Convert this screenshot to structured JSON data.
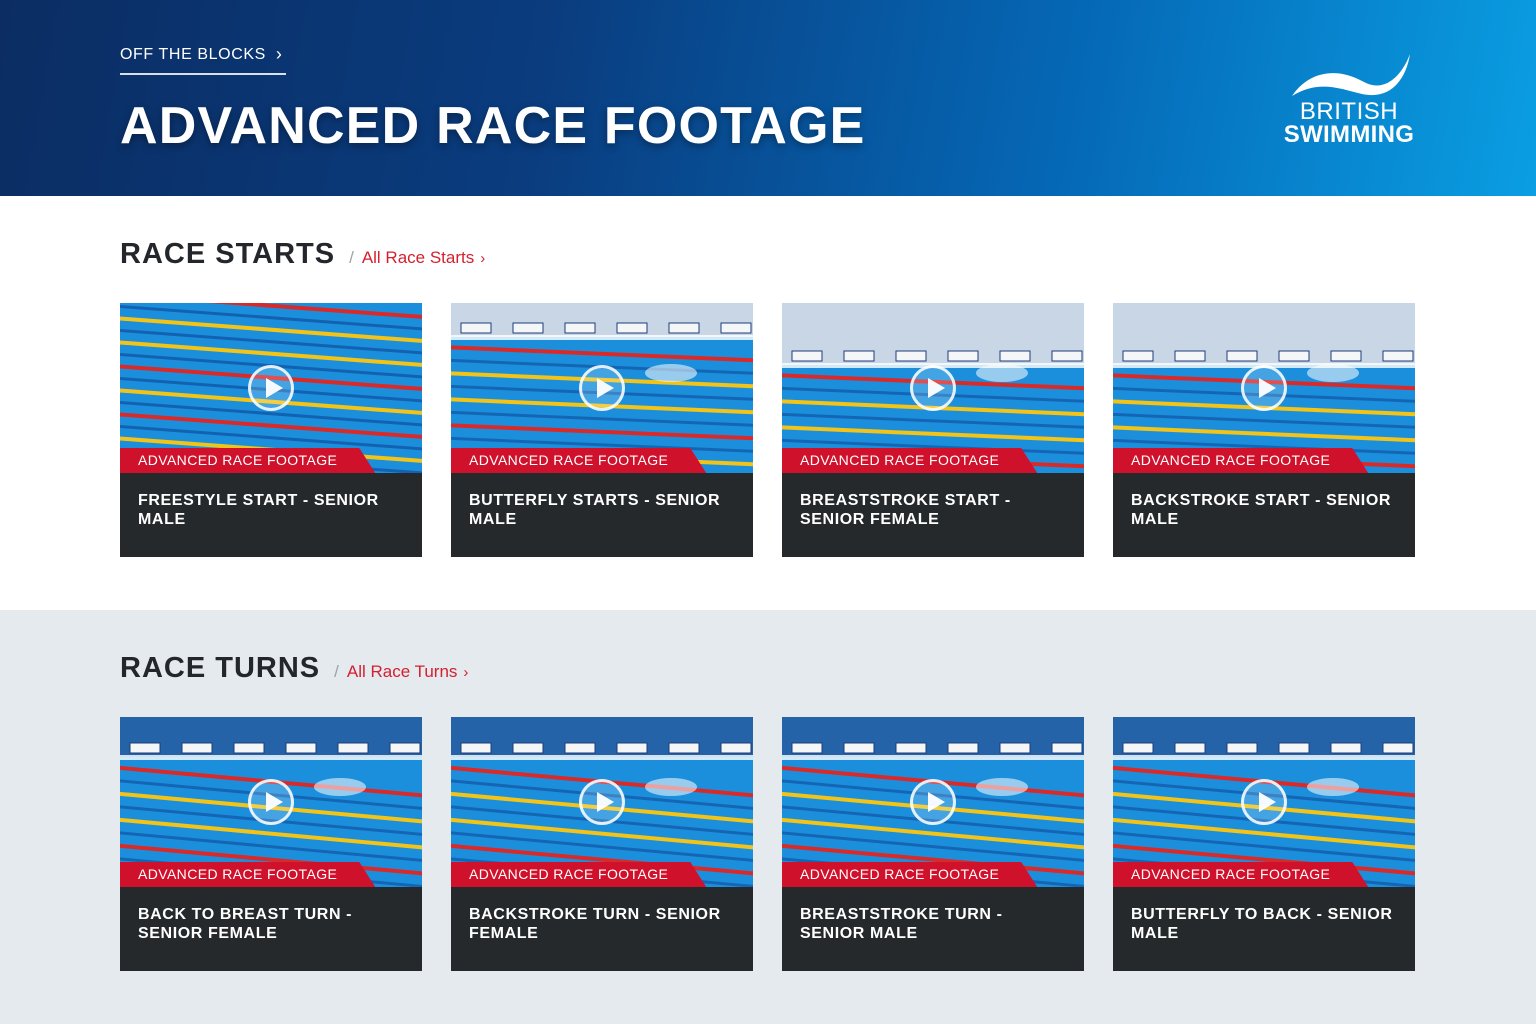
{
  "hero": {
    "breadcrumb": "OFF THE BLOCKS",
    "title": "ADVANCED RACE FOOTAGE",
    "logo_line1": "BRITISH",
    "logo_line2": "SWIMMING",
    "gradient_colors": [
      "#0b2d63",
      "#0569b7",
      "#0a9ee2"
    ]
  },
  "colors": {
    "accent_red": "#d0112b",
    "card_bg": "#25292c",
    "section_alt_bg": "#e4eaee"
  },
  "sections": [
    {
      "title": "RACE STARTS",
      "link_label": "All Race Starts",
      "cards": [
        {
          "tag": "ADVANCED RACE FOOTAGE",
          "title": "FREESTYLE START - SENIOR MALE"
        },
        {
          "tag": "ADVANCED RACE FOOTAGE",
          "title": "BUTTERFLY STARTS - SENIOR MALE"
        },
        {
          "tag": "ADVANCED RACE FOOTAGE",
          "title": "BREASTSTROKE START - SENIOR FEMALE"
        },
        {
          "tag": "ADVANCED RACE FOOTAGE",
          "title": "BACKSTROKE START - SENIOR MALE"
        }
      ]
    },
    {
      "title": "RACE TURNS",
      "link_label": "All Race Turns",
      "cards": [
        {
          "tag": "ADVANCED RACE FOOTAGE",
          "title": "BACK TO BREAST TURN - SENIOR FEMALE"
        },
        {
          "tag": "ADVANCED RACE FOOTAGE",
          "title": "BACKSTROKE TURN - SENIOR FEMALE"
        },
        {
          "tag": "ADVANCED RACE FOOTAGE",
          "title": "BREASTSTROKE TURN - SENIOR MALE"
        },
        {
          "tag": "ADVANCED RACE FOOTAGE",
          "title": "BUTTERFLY TO BACK - SENIOR MALE"
        }
      ]
    }
  ],
  "icons": {
    "play": "play-icon",
    "chevron": "chevron-right-icon"
  }
}
